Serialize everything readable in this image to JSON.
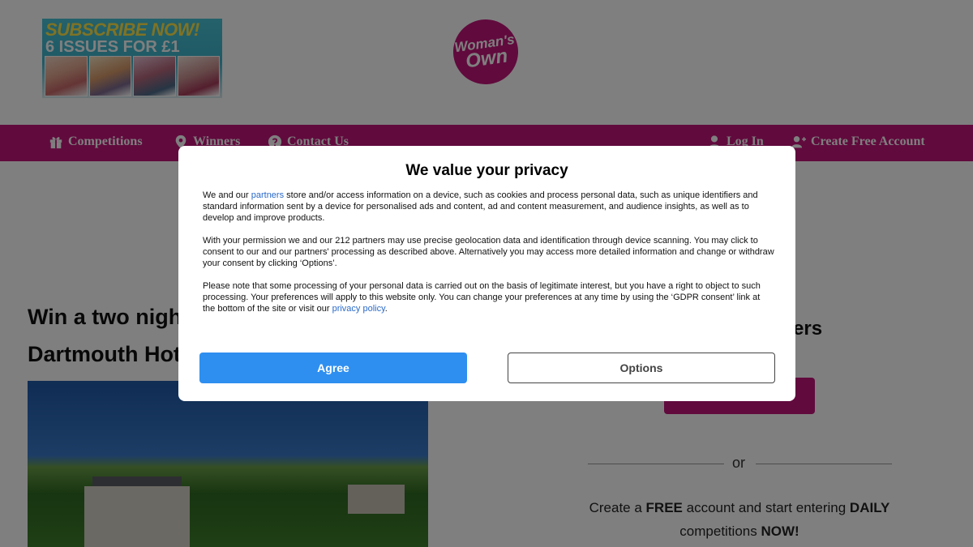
{
  "header": {
    "promo": {
      "line1": "SUBSCRIBE NOW!",
      "line2": "6 ISSUES FOR £1"
    },
    "logo": {
      "line1": "Woman's",
      "line2": "Own"
    }
  },
  "nav": {
    "items": [
      {
        "label": "Competitions",
        "icon": "gift-icon"
      },
      {
        "label": "Winners",
        "icon": "location-pin-icon"
      },
      {
        "label": "Contact Us",
        "icon": "question-circle-icon"
      },
      {
        "label": "Log In",
        "icon": "user-icon"
      },
      {
        "label": "Create Free Account",
        "icon": "user-plus-icon"
      }
    ]
  },
  "article": {
    "title_line1": "Win a two nigh",
    "title_line2": "Dartmouth Hot"
  },
  "sidebar": {
    "heading_fragment": "ers",
    "or_label": "or",
    "signup": {
      "part1": "Create a ",
      "free": "FREE",
      "part2": " account and start entering ",
      "daily": "DAILY",
      "part3": " competitions ",
      "now": "NOW!"
    }
  },
  "consent": {
    "title": "We value your privacy",
    "p1_before": "We and our ",
    "p1_link": "partners",
    "p1_after": " store and/or access information on a device, such as cookies and process personal data, such as unique identifiers and standard information sent by a device for personalised ads and content, ad and content measurement, and audience insights, as well as to develop and improve products.",
    "p2": "With your permission we and our 212 partners may use precise geolocation data and identification through device scanning. You may click to consent to our and our partners' processing as described above. Alternatively you may access more detailed information and change or withdraw your consent by clicking ‘Options’.",
    "p3_before": "Please note that some processing of your personal data is carried out on the basis of legitimate interest, but you have a right to object to such processing. Your preferences will apply to this website only. You can change your preferences at any time by using the ‘GDPR consent’ link at the bottom of the site or visit our ",
    "p3_link": "privacy policy",
    "p3_after": ".",
    "agree_label": "Agree",
    "options_label": "Options"
  },
  "colors": {
    "brand": "#c2147a",
    "agree": "#2e8ff0",
    "link": "#2a6ac8"
  }
}
